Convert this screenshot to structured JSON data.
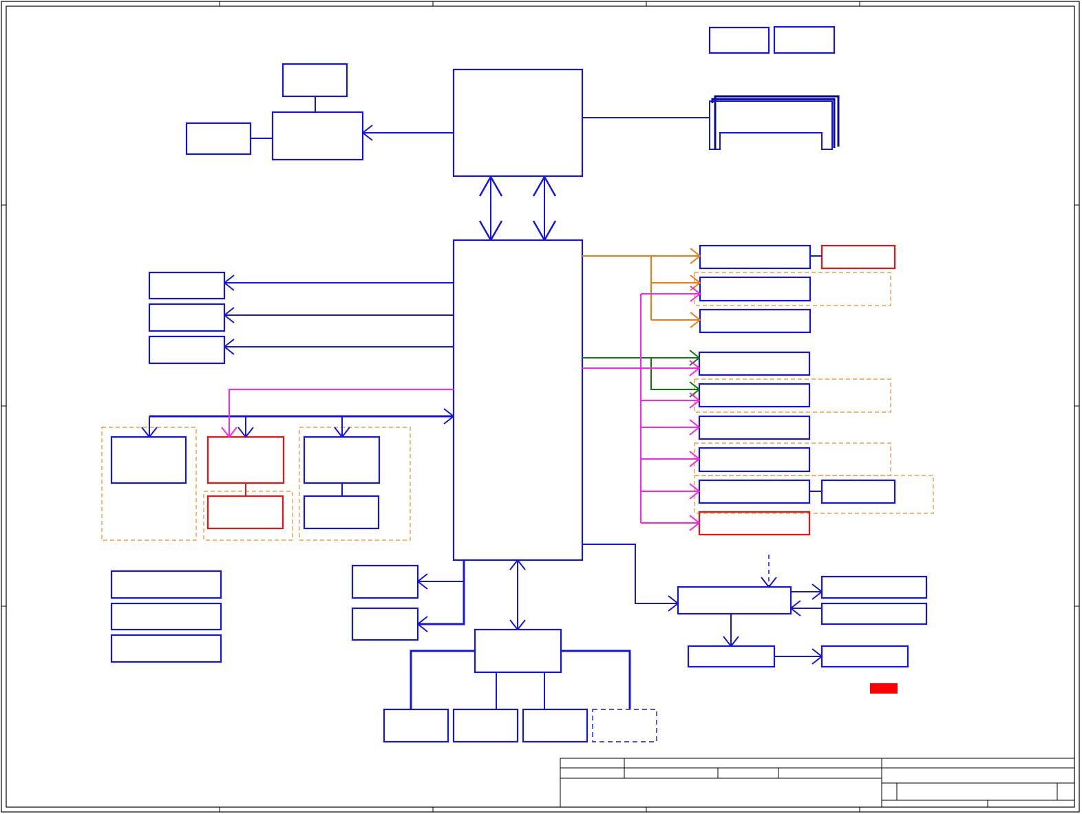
{
  "canvas": {
    "background": "#ffffff"
  },
  "colors": {
    "block": "#1414e6",
    "block_alt": "#ee1111",
    "group_outline": "#f08a24",
    "bus_orange": "#f07a10",
    "bus_green": "#0a7a0a",
    "bus_magenta": "#ff22ee",
    "connector": "#0a0a9a",
    "marker": "#ff0000",
    "frame": "#000000"
  },
  "diagram": {
    "kind": "block-diagram",
    "text_labels": []
  }
}
